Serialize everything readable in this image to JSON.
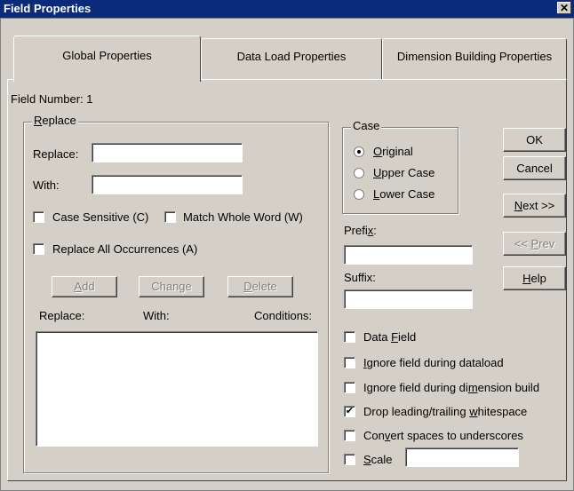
{
  "window": {
    "title": "Field Properties",
    "close_glyph": "✕"
  },
  "tabs": [
    {
      "label": "Global Properties",
      "active": true
    },
    {
      "label": "Data Load Properties",
      "active": false
    },
    {
      "label": "Dimension Building Properties",
      "active": false
    }
  ],
  "field_number": {
    "label": "Field Number:",
    "value": "1"
  },
  "replace_group": {
    "title_first": "R",
    "title_rest": "eplace",
    "replace_label": "Replace:",
    "replace_value": "",
    "with_label": "With:",
    "with_value": "",
    "case_sensitive": {
      "label": "Case Sensitive (C)",
      "checked": false
    },
    "match_whole_word": {
      "label": "Match Whole Word (W)",
      "checked": false
    },
    "replace_all": {
      "label": "Replace All Occurrences (A)",
      "checked": false
    },
    "add_button_first": "A",
    "add_button_rest": "dd",
    "change_button": "Change",
    "delete_button_first": "D",
    "delete_button_rest": "elete",
    "list_headers": {
      "replace": "Replace:",
      "with": "With:",
      "conditions": "Conditions:"
    }
  },
  "case_group": {
    "title": "Case",
    "options": [
      {
        "first": "O",
        "rest": "riginal",
        "selected": true
      },
      {
        "first": "U",
        "rest": "pper Case",
        "selected": false
      },
      {
        "first": "L",
        "rest": "ower Case",
        "selected": false
      }
    ]
  },
  "prefix": {
    "label_pre": "Prefi",
    "label_mn": "x",
    "label_post": ":",
    "value": ""
  },
  "suffix": {
    "label": "Suffix:",
    "value": ""
  },
  "options": {
    "data_field": {
      "pre": "Data ",
      "mn": "F",
      "post": "ield",
      "checked": false
    },
    "ignore_dataload": {
      "pre": "",
      "mn": "I",
      "post": "gnore field during dataload",
      "checked": false
    },
    "ignore_dimbuild": {
      "pre": "Ignore field during di",
      "mn": "m",
      "post": "ension build",
      "checked": false
    },
    "drop_whitespace": {
      "pre": "Drop leading/trailing ",
      "mn": "w",
      "post": "hitespace",
      "checked": true
    },
    "convert_spaces": {
      "pre": "Con",
      "mn": "v",
      "post": "ert spaces to underscores",
      "checked": false
    },
    "scale": {
      "pre": "",
      "mn": "S",
      "post": "cale",
      "checked": false,
      "value": ""
    }
  },
  "buttons": {
    "ok": "OK",
    "cancel": "Cancel",
    "next_first": "N",
    "next_rest": "ext >>",
    "prev_pre": "<< ",
    "prev_mn": "P",
    "prev_post": "rev",
    "help_first": "H",
    "help_rest": "elp"
  },
  "check_glyph": "✔"
}
